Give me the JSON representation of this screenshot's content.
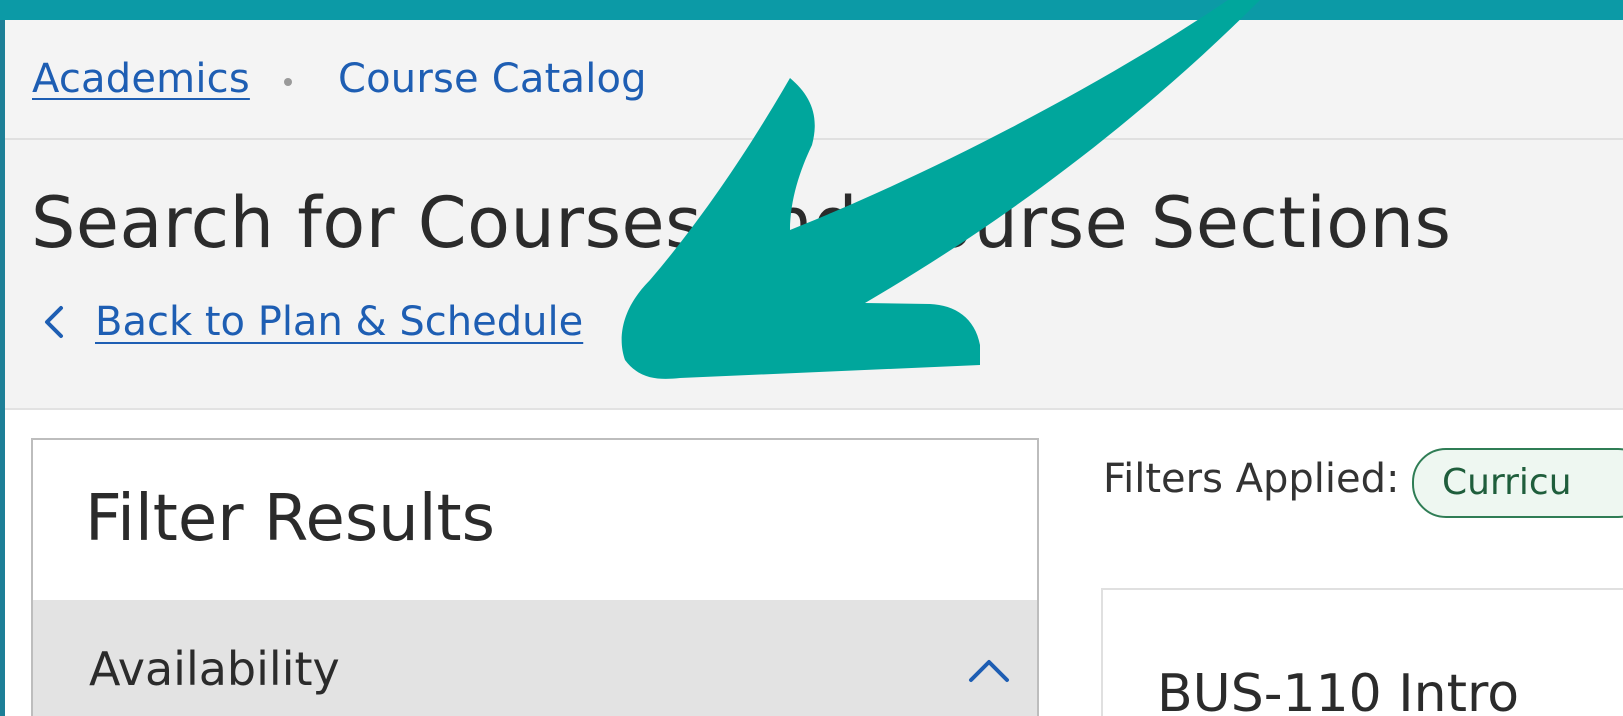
{
  "breadcrumb": {
    "items": [
      {
        "label": "Academics"
      },
      {
        "label": "Course Catalog"
      }
    ]
  },
  "page": {
    "title": "Search for Courses and Course Sections",
    "back_link": "Back to Plan & Schedule"
  },
  "filters": {
    "panel_title": "Filter Results",
    "sections": [
      {
        "label": "Availability",
        "expanded": true
      }
    ]
  },
  "results": {
    "filters_applied_label": "Filters Applied:",
    "chips": [
      {
        "label": "Curricu"
      }
    ],
    "first_course_title": "BUS-110 Intro"
  },
  "icons": {
    "back": "chevron-left-icon",
    "availability_toggle": "chevron-up-icon",
    "annotation": "arrow-icon"
  },
  "colors": {
    "link": "#1e5eb3",
    "annotation_arrow": "#00a69c",
    "chip_border": "#2f7d55",
    "top_stripe": "#0c9aa6"
  }
}
